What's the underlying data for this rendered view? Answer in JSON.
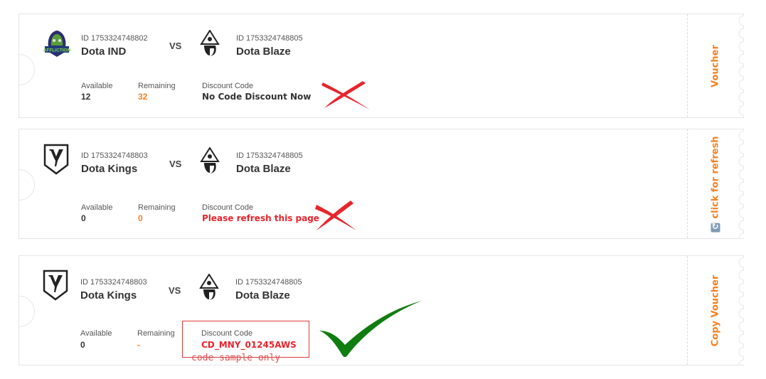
{
  "vouchers": [
    {
      "team_a": {
        "id": "ID 1753324748802",
        "name": "Dota IND",
        "logo_text": "AFFLICTION"
      },
      "vs": "VS",
      "team_b": {
        "id": "ID 1753324748805",
        "name": "Dota Blaze"
      },
      "available_label": "Available",
      "available_value": "12",
      "remaining_label": "Remaining",
      "remaining_value": "32",
      "code_label": "Discount Code",
      "code_value": "No Code Discount Now",
      "stub_label": "Voucher",
      "status_mark": "red-cross"
    },
    {
      "team_a": {
        "id": "ID 1753324748803",
        "name": "Dota Kings",
        "logo_text": "Y"
      },
      "vs": "VS",
      "team_b": {
        "id": "ID 1753324748805",
        "name": "Dota Blaze"
      },
      "available_label": "Available",
      "available_value": "0",
      "remaining_label": "Remaining",
      "remaining_value": "0",
      "code_label": "Discount Code",
      "code_value": "Please refresh this page",
      "stub_label": "click for refresh",
      "status_mark": "red-cross"
    },
    {
      "team_a": {
        "id": "ID 1753324748803",
        "name": "Dota Kings",
        "logo_text": "Y"
      },
      "vs": "VS",
      "team_b": {
        "id": "ID 1753324748805",
        "name": "Dota Blaze"
      },
      "available_label": "Available",
      "available_value": "0",
      "remaining_label": "Remaining",
      "remaining_value": "-",
      "code_label": "Discount Code",
      "code_value": "CD_MNY_01245AWS",
      "code_note": "code sample only",
      "stub_label": "Copy Voucher",
      "status_mark": "green-check"
    }
  ],
  "colors": {
    "accent_orange": "#f58020",
    "error_red": "#e8242c",
    "check_green": "#0f7d0f",
    "text_dark": "#333333"
  }
}
